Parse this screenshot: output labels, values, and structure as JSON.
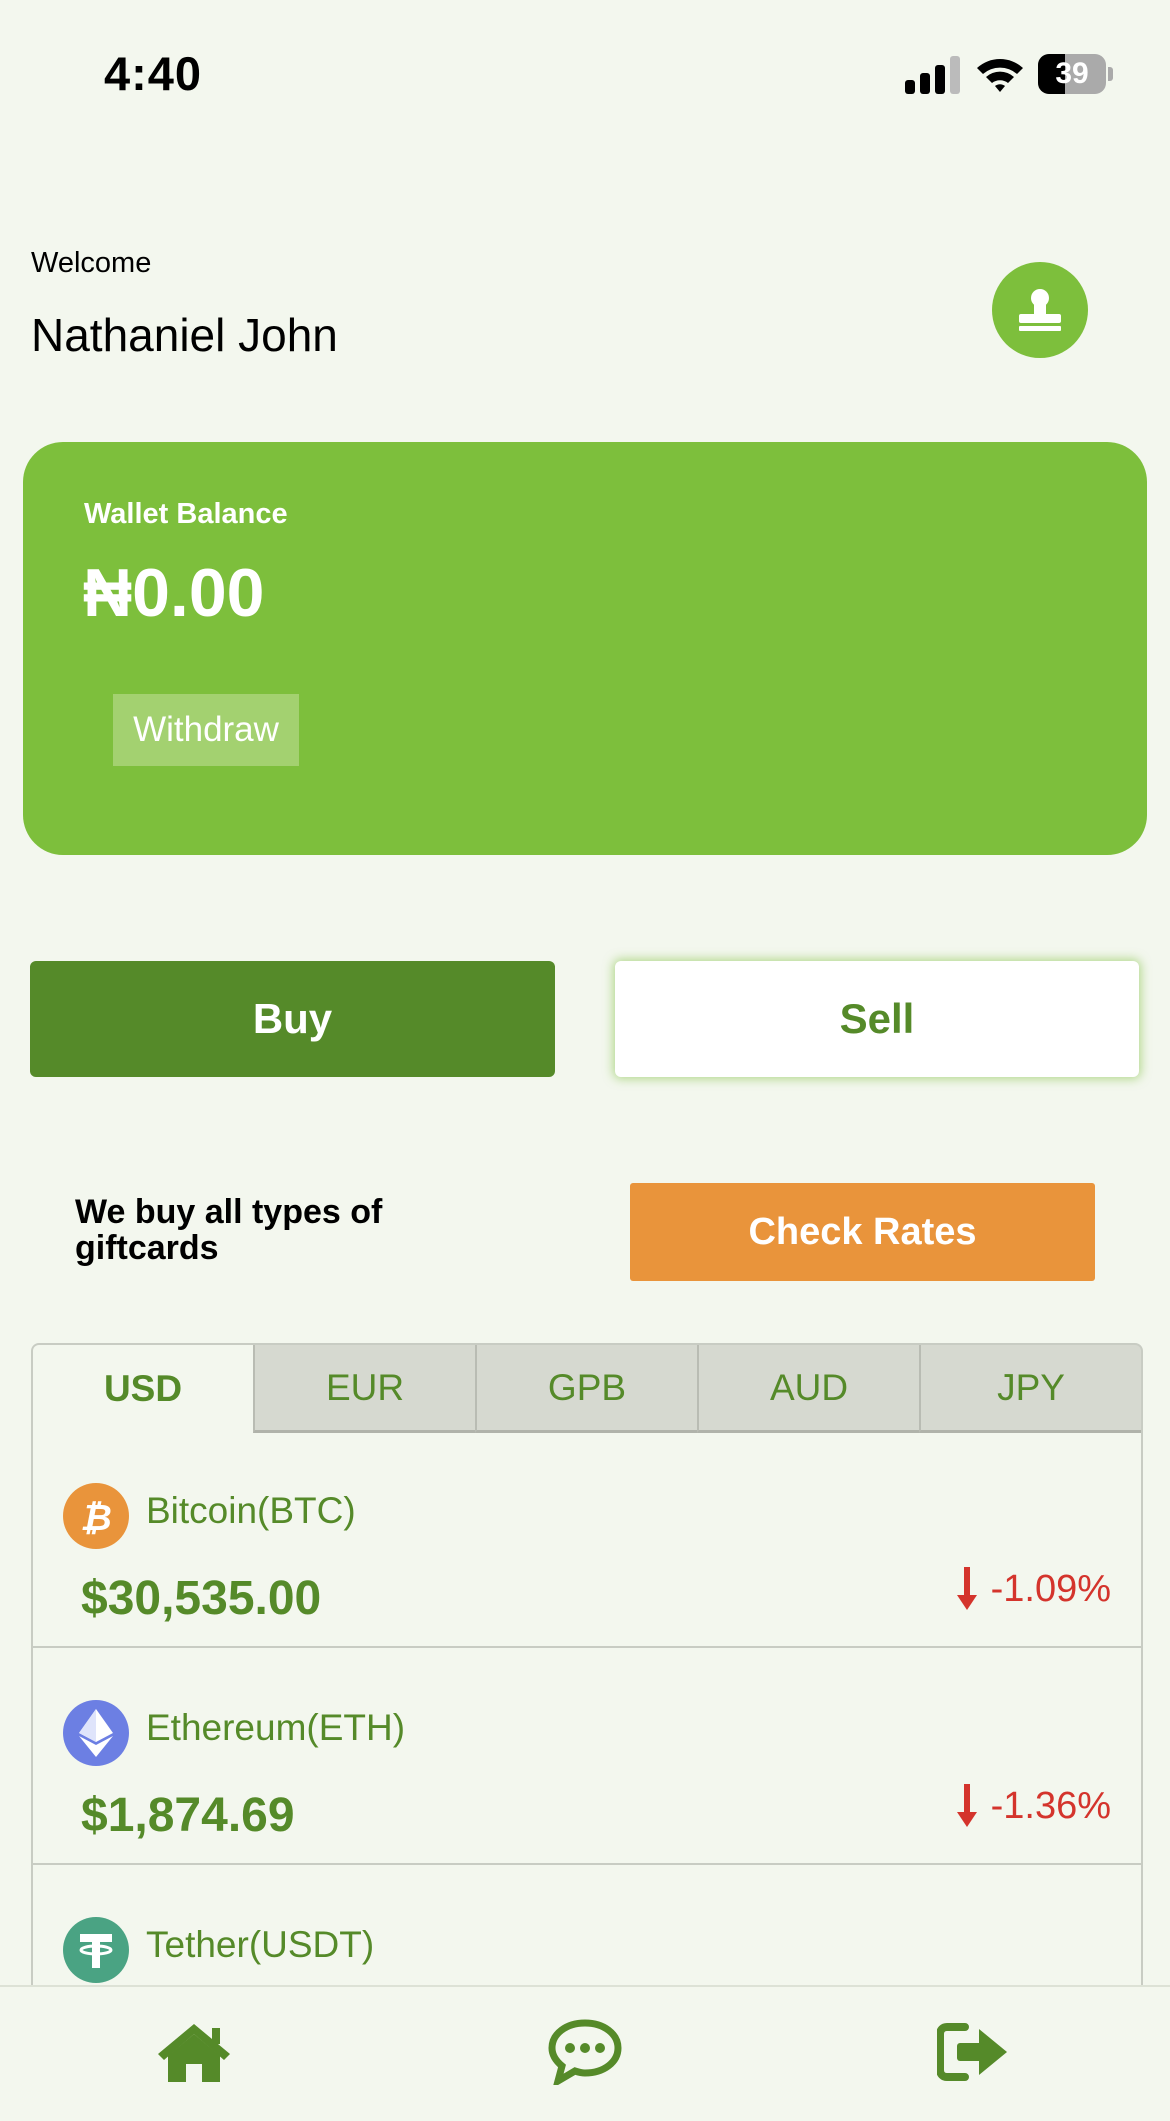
{
  "status_bar": {
    "time": "4:40",
    "battery": "39",
    "battery_level": 0.39
  },
  "header": {
    "welcome": "Welcome",
    "user_name": "Nathaniel John",
    "profile_icon": "stamp-icon"
  },
  "wallet": {
    "label": "Wallet Balance",
    "amount": "₦0.00",
    "withdraw_label": "Withdraw"
  },
  "actions": {
    "buy_label": "Buy",
    "sell_label": "Sell"
  },
  "promo": {
    "text": "We buy all types of giftcards",
    "check_rates_label": "Check Rates"
  },
  "tabs": [
    {
      "label": "USD",
      "active": true
    },
    {
      "label": "EUR",
      "active": false
    },
    {
      "label": "GPB",
      "active": false
    },
    {
      "label": "AUD",
      "active": false
    },
    {
      "label": "JPY",
      "active": false
    }
  ],
  "coins": [
    {
      "name": "Bitcoin(BTC)",
      "price": "$30,535.00",
      "change": "-1.09%",
      "icon": "bitcoin-icon",
      "color": "#e9943b"
    },
    {
      "name": "Ethereum(ETH)",
      "price": "$1,874.69",
      "change": "-1.36%",
      "icon": "ethereum-icon",
      "color": "#6c7fe3"
    },
    {
      "name": "Tether(USDT)",
      "price": "",
      "change": "",
      "icon": "tether-icon",
      "color": "#4aa383"
    }
  ],
  "nav": [
    {
      "icon": "home-icon"
    },
    {
      "icon": "chat-icon"
    },
    {
      "icon": "logout-icon"
    }
  ],
  "colors": {
    "background": "#f3f7ee",
    "primary_green": "#7dbf3c",
    "dark_green": "#558a29",
    "orange": "#e9943b",
    "negative_red": "#d4342c"
  }
}
